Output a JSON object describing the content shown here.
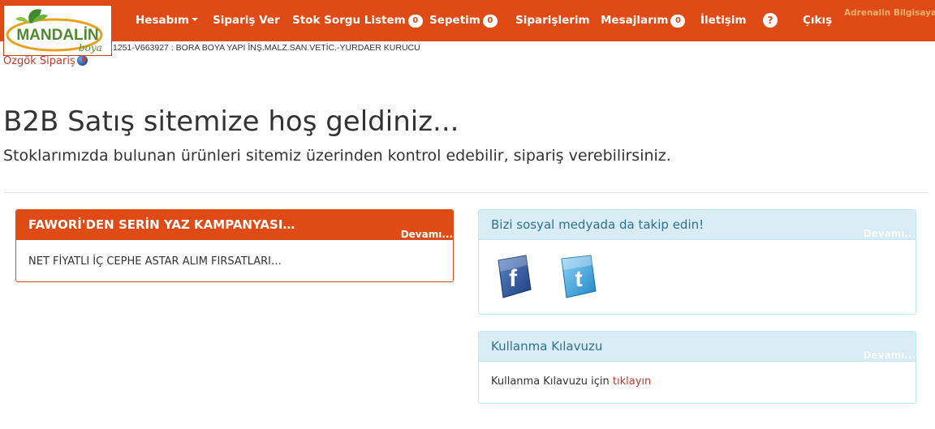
{
  "brand": {
    "logo_text": "MANDALİN",
    "logo_sub": "boya"
  },
  "nav": {
    "hesabim": "Hesabım",
    "siparis_ver": "Sipariş Ver",
    "stok_sorgu": "Stok Sorgu Listem",
    "stok_sorgu_count": "0",
    "sepetim": "Sepetim",
    "sepetim_count": "0",
    "siparislerim": "Siparişlerim",
    "mesajlarim": "Mesajlarım",
    "mesajlarim_count": "0",
    "iletisim": "İletişim",
    "help": "?",
    "cikis": "Çıkış",
    "user": "Adrenalin Bilgisayar"
  },
  "account_line": "1251-V663927 : BORA BOYA YAPI İNŞ.MALZ.SAN.VETİC.-YURDAER KURUCU",
  "ozgok_link": "Özgök Sipariş",
  "hero": {
    "title": "B2B Satış sitemize hoş geldiniz...",
    "subtitle": "Stoklarımızda bulunan ürünleri sitemiz üzerinden kontrol edebilir, sipariş verebilirsiniz."
  },
  "panels": {
    "campaign": {
      "title": "FAWORİ'DEN SERİN YAZ KAMPANYASI…",
      "more": "Devamı...",
      "body": "NET FİYATLI İÇ CEPHE ASTAR ALIM FIRSATLARI…"
    },
    "social": {
      "title": "Bizi sosyal medyada da takip edin!",
      "more": "Devamı...",
      "facebook_letter": "f",
      "twitter_letter": "t"
    },
    "guide": {
      "title": "Kullanma Kılavuzu",
      "more": "Devamı...",
      "body_prefix": "Kullanma Kılavuzu için ",
      "body_link": "tıklayın"
    }
  },
  "colors": {
    "brand_orange": "#e04a14",
    "info_bg": "#d9edf7",
    "info_text": "#31708f",
    "link_red": "#c0392b"
  },
  "icons": [
    "caret-down-icon",
    "help-icon",
    "globe-icon",
    "facebook-icon",
    "twitter-icon",
    "logo-leaf-icon"
  ]
}
